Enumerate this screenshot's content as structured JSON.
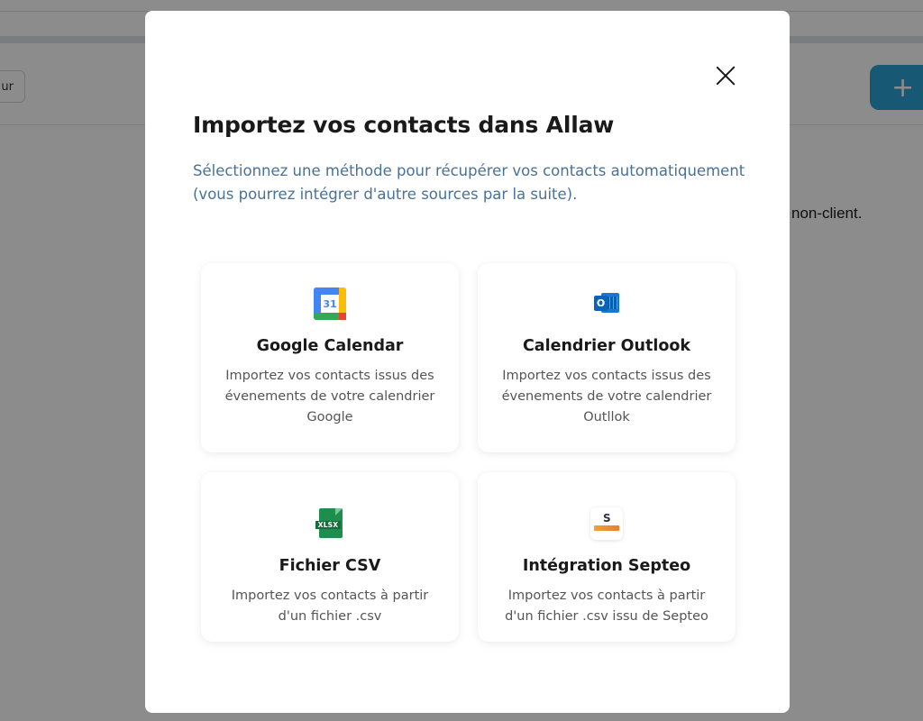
{
  "background": {
    "left_button_label": "ur",
    "add_button_label": "+",
    "side_text": "non-client."
  },
  "modal": {
    "title": "Importez vos contacts dans Allaw",
    "subtitle": "Sélectionnez une méthode pour récupérer vos contacts automatiquement (vous pourrez intégrer d'autre sources par la suite).",
    "options": [
      {
        "title": "Google Calendar",
        "description": "Importez vos contacts issus des évenements de votre calendrier Google",
        "icon": "google-calendar-icon",
        "icon_text": "31"
      },
      {
        "title": "Calendrier Outlook",
        "description": "Importez vos contacts issus des évenements de votre calendrier Outllok",
        "icon": "outlook-icon",
        "icon_text": "O"
      },
      {
        "title": "Fichier CSV",
        "description": "Importez vos contacts à partir d'un fichier .csv",
        "icon": "xlsx-file-icon",
        "icon_text": "XLSX"
      },
      {
        "title": "Intégration Septeo",
        "description": "Importez vos contacts à partir d'un fichier .csv issu de Septeo",
        "icon": "septeo-icon",
        "icon_text": "S"
      }
    ]
  },
  "colors": {
    "subtitle": "#4a7196",
    "primary_button": "#2aa3d6"
  }
}
